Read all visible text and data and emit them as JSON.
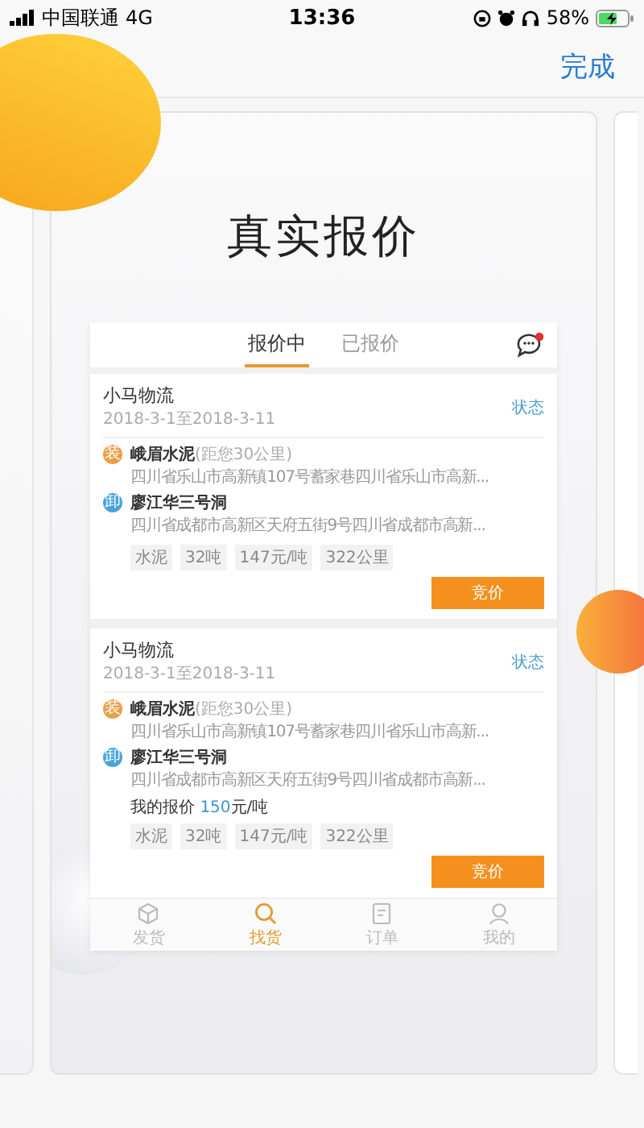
{
  "status_bar": {
    "carrier": "中国联通",
    "network": "4G",
    "time": "13:36",
    "battery": "58%"
  },
  "top_bar": {
    "done": "完成"
  },
  "slide": {
    "title": "真实报价"
  },
  "preview": {
    "tabs": [
      {
        "label": "报价中",
        "selected": true
      },
      {
        "label": "已报价",
        "selected": false
      }
    ],
    "chat_unread": true,
    "orders": [
      {
        "company": "小马物流",
        "dates": "2018-3-1至2018-3-11",
        "status": "状态",
        "stops": [
          {
            "kind": "load",
            "mark": "装",
            "name": "峨眉水泥",
            "note": "(距您30公里)",
            "address": "四川省乐山市高新镇107号蓄家巷四川省乐山市高新..."
          },
          {
            "kind": "unload",
            "mark": "卸",
            "name": "廖江华三号洞",
            "address": "四川省成都市高新区天府五街9号四川省成都市高新..."
          }
        ],
        "tags": [
          "水泥",
          "32吨",
          "147元/吨",
          "322公里"
        ],
        "button": "竞价"
      },
      {
        "company": "小马物流",
        "dates": "2018-3-1至2018-3-11",
        "status": "状态",
        "stops": [
          {
            "kind": "load",
            "mark": "装",
            "name": "峨眉水泥",
            "note": "(距您30公里)",
            "address": "四川省乐山市高新镇107号蓄家巷四川省乐山市高新..."
          },
          {
            "kind": "unload",
            "mark": "卸",
            "name": "廖江华三号洞",
            "address": "四川省成都市高新区天府五街9号四川省成都市高新..."
          }
        ],
        "my_quote": {
          "label": "我的报价",
          "amount": "150",
          "unit": "元/吨"
        },
        "tags": [
          "水泥",
          "32吨",
          "147元/吨",
          "322公里"
        ],
        "button": "竞价"
      }
    ],
    "nav": [
      {
        "kind": "box",
        "label": "发货",
        "selected": false
      },
      {
        "kind": "search",
        "label": "找货",
        "selected": true
      },
      {
        "kind": "doc",
        "label": "订单",
        "selected": false
      },
      {
        "kind": "person",
        "label": "我的",
        "selected": false
      }
    ]
  }
}
